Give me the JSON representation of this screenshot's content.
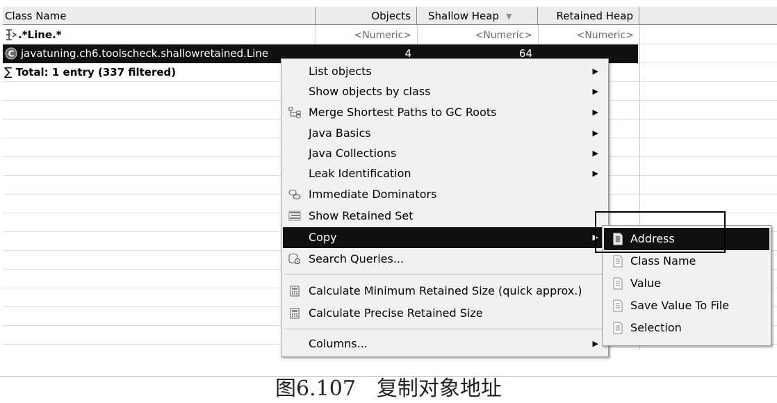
{
  "table": {
    "columns": [
      {
        "label": "Class Name"
      },
      {
        "label": "Objects"
      },
      {
        "label": "Shallow Heap",
        "sort": "▼"
      },
      {
        "label": "Retained Heap"
      }
    ],
    "filter_row": {
      "name": ".*Line.*",
      "objects": "<Numeric>",
      "shallow": "<Numeric>",
      "retained": "<Numeric>"
    },
    "selected_row": {
      "name": "javatuning.ch6.toolscheck.shallowretained.Line",
      "objects": "4",
      "shallow": "64",
      "retained": ""
    },
    "total_row": {
      "symbol": "∑",
      "label": "Total: 1 entry (337 filtered)"
    }
  },
  "context_menu": {
    "items": [
      {
        "label": "List objects",
        "submenu": true,
        "icon": "none"
      },
      {
        "label": "Show objects by class",
        "submenu": true,
        "icon": "none"
      },
      {
        "label": "Merge Shortest Paths to GC Roots",
        "submenu": true,
        "icon": "tree-paths-icon"
      },
      {
        "label": "Java Basics",
        "submenu": true,
        "icon": "none"
      },
      {
        "label": "Java Collections",
        "submenu": true,
        "icon": "none"
      },
      {
        "label": "Leak Identification",
        "submenu": true,
        "icon": "none"
      },
      {
        "label": "Immediate Dominators",
        "submenu": false,
        "icon": "dominators-icon"
      },
      {
        "label": "Show Retained Set",
        "submenu": false,
        "icon": "retained-set-icon"
      },
      {
        "label": "Copy",
        "submenu": true,
        "icon": "none",
        "active": true
      },
      {
        "label": "Search Queries...",
        "submenu": false,
        "icon": "search-queries-icon"
      },
      {
        "label": "Calculate Minimum Retained Size (quick approx.)",
        "submenu": false,
        "icon": "calculator-icon"
      },
      {
        "label": "Calculate Precise Retained Size",
        "submenu": false,
        "icon": "calculator-icon"
      },
      {
        "label": "Columns...",
        "submenu": true,
        "icon": "none"
      }
    ],
    "arrow": "▶"
  },
  "copy_submenu": {
    "items": [
      {
        "label": "Address",
        "active": true
      },
      {
        "label": "Class Name"
      },
      {
        "label": "Value"
      },
      {
        "label": "Save Value To File"
      },
      {
        "label": "Selection"
      }
    ]
  },
  "caption": "图6.107　复制对象地址",
  "colors": {
    "header_bg": "#ececec",
    "selection_bg": "#101010",
    "menu_bg": "#f1f1f1"
  }
}
